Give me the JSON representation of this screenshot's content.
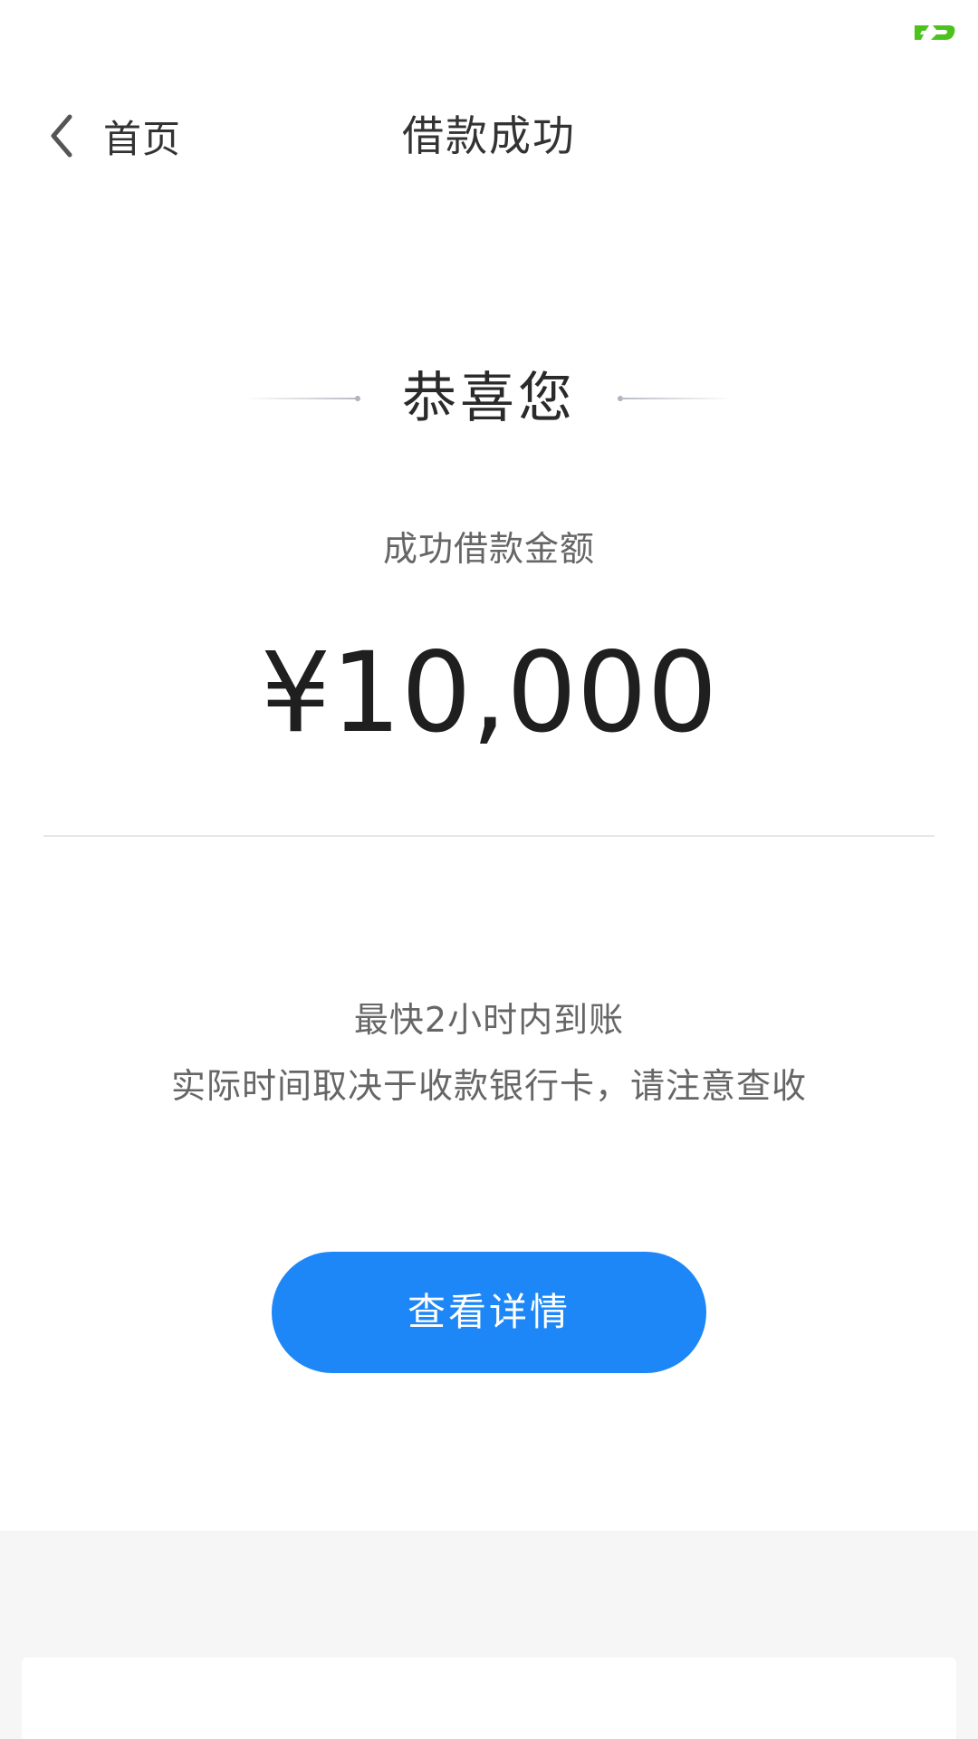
{
  "status_bar": {
    "logo_icon": "app-logo-icon",
    "logo_color": "#4cc21c"
  },
  "nav": {
    "back_icon": "chevron-left-icon",
    "back_label": "首页",
    "title": "借款成功"
  },
  "congrats": {
    "text": "恭喜您"
  },
  "amount": {
    "label": "成功借款金额",
    "value": "¥10,000"
  },
  "arrival": {
    "line1": "最快2小时内到账",
    "line2": "实际时间取决于收款银行卡，请注意查收"
  },
  "actions": {
    "detail_button_label": "查看详情",
    "detail_button_color": "#1e87f8"
  }
}
